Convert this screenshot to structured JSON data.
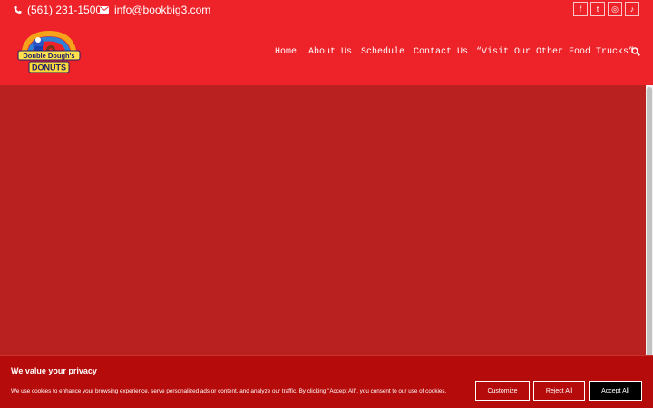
{
  "topbar": {
    "phone": "(561) 231-1500",
    "email": "info@bookbig3.com",
    "socials": [
      {
        "icon": "facebook-icon",
        "glyph": "f"
      },
      {
        "icon": "twitter-icon",
        "glyph": "t"
      },
      {
        "icon": "instagram-icon",
        "glyph": "◎"
      },
      {
        "icon": "tiktok-icon",
        "glyph": "♪"
      }
    ]
  },
  "logo": {
    "line1": "Double Dough's",
    "line2": "DONUTS"
  },
  "nav": {
    "items": [
      "Home",
      "About Us",
      "Schedule",
      "Contact Us",
      "“Visit Our Other Food Trucks”"
    ]
  },
  "colors": {
    "header_bg": "#ee2229",
    "hero_bg": "#b92020",
    "banner_bg": "#b50b0b",
    "accept_bg": "#000000"
  },
  "cookie_banner": {
    "title": "We value your privacy",
    "text": "We use cookies to enhance your browsing experience, serve personalized ads or content, and analyze our traffic. By clicking \"Accept All\", you consent to our use of cookies.",
    "customize_label": "Customize",
    "reject_label": "Reject All",
    "accept_label": "Accept All"
  }
}
